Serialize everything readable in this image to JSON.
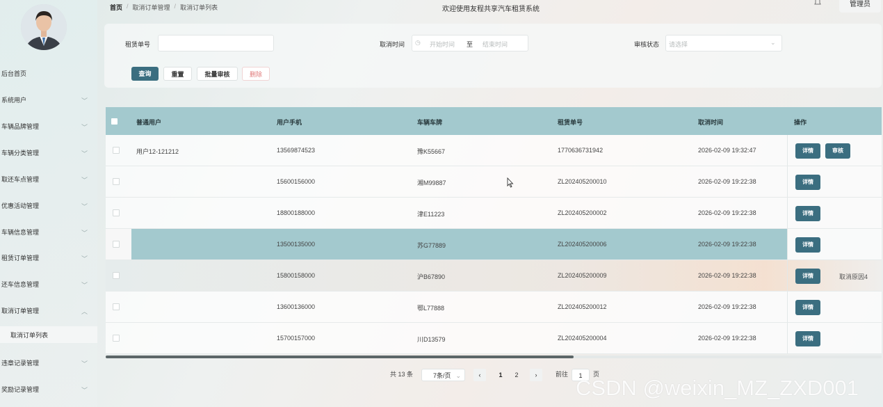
{
  "header": {
    "breadcrumb": [
      "首页",
      "取消订单管理",
      "取消订单列表"
    ],
    "welcome": "欢迎使用友程共享汽车租赁系统",
    "user": "管理员"
  },
  "sidebar": {
    "items": [
      {
        "label": "后台首页",
        "chevron": false
      },
      {
        "label": "系统用户",
        "chevron": true
      },
      {
        "label": "车辆品牌管理",
        "chevron": true
      },
      {
        "label": "车辆分类管理",
        "chevron": true
      },
      {
        "label": "取还车点管理",
        "chevron": true
      },
      {
        "label": "优惠活动管理",
        "chevron": true
      },
      {
        "label": "车辆信息管理",
        "chevron": true
      },
      {
        "label": "租赁订单管理",
        "chevron": true
      },
      {
        "label": "还车信息管理",
        "chevron": true
      },
      {
        "label": "取消订单管理",
        "chevron": true,
        "expanded": true
      },
      {
        "label": "取消订单列表",
        "chevron": false,
        "active": true
      },
      {
        "label": "违章记录管理",
        "chevron": true
      },
      {
        "label": "奖励记录管理",
        "chevron": true
      }
    ]
  },
  "search": {
    "order_label": "租赁单号",
    "order_value": "",
    "time_label": "取消时间",
    "start_placeholder": "开始时间",
    "to": "至",
    "end_placeholder": "结束时间",
    "status_label": "审核状态",
    "status_placeholder": "请选择",
    "buttons": {
      "query": "查询",
      "reset": "重置",
      "batch_review": "批量审核",
      "delete": "删除"
    }
  },
  "table": {
    "headers": [
      "普通用户",
      "用户手机",
      "车辆车牌",
      "租赁单号",
      "取消时间",
      "操作"
    ],
    "rows": [
      {
        "user": "用户12-121212",
        "phone": "13569874523",
        "plate": "豫K55667",
        "order": "1770636731942",
        "time": "2026-02-09 19:32:47",
        "actions": [
          "详情",
          "审核"
        ],
        "reason": ""
      },
      {
        "user": "",
        "phone": "15600156000",
        "plate": "湘M99887",
        "order": "ZL202405200010",
        "time": "2026-02-09 19:22:38",
        "actions": [
          "详情"
        ],
        "reason": ""
      },
      {
        "user": "",
        "phone": "18800188000",
        "plate": "津E11223",
        "order": "ZL202405200002",
        "time": "2026-02-09 19:22:38",
        "actions": [
          "详情"
        ],
        "reason": ""
      },
      {
        "user": "",
        "phone": "13500135000",
        "plate": "苏G77889",
        "order": "ZL202405200006",
        "time": "2026-02-09 19:22:38",
        "actions": [
          "详情"
        ],
        "reason": ""
      },
      {
        "user": "",
        "phone": "15800158000",
        "plate": "沪B67890",
        "order": "ZL202405200009",
        "time": "2026-02-09 19:22:38",
        "actions": [
          "详情"
        ],
        "reason": "取消原因4"
      },
      {
        "user": "",
        "phone": "13600136000",
        "plate": "鄂L77888",
        "order": "ZL202405200012",
        "time": "2026-02-09 19:22:38",
        "actions": [
          "详情"
        ],
        "reason": ""
      },
      {
        "user": "",
        "phone": "15700157000",
        "plate": "川D13579",
        "order": "ZL202405200004",
        "time": "2026-02-09 19:22:38",
        "actions": [
          "详情"
        ],
        "reason": ""
      }
    ]
  },
  "pagination": {
    "total": "共 13 条",
    "page_size": "7条/页",
    "pages": [
      "1",
      "2"
    ],
    "current": "1",
    "goto_label": "前往",
    "goto_value": "1",
    "goto_unit": "页"
  },
  "watermark": "CSDN @weixin_MZ_ZXD001",
  "colors": {
    "primary": "#3b6e80",
    "header_bg": "#a3c9ce",
    "danger": "#e07b7b"
  }
}
